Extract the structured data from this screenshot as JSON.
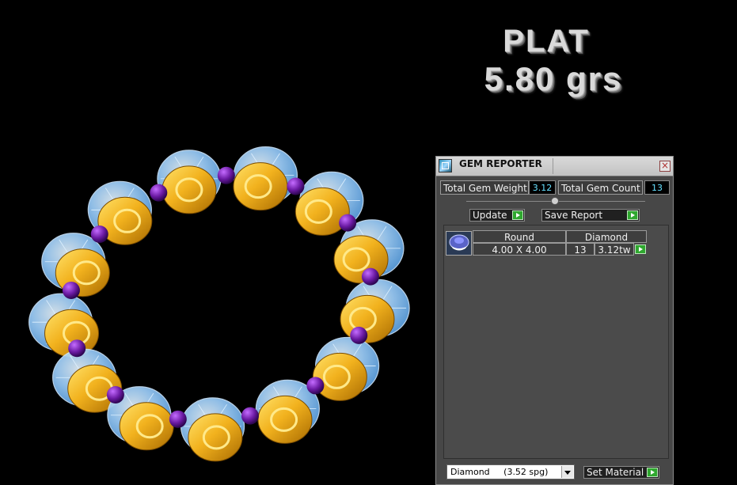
{
  "overlay": {
    "line1": "PLAT",
    "line2": "5.80 grs"
  },
  "panel": {
    "title": "GEM REPORTER",
    "close_label": "×",
    "total_gem_weight_label": "Total Gem Weight",
    "total_gem_weight_value": "3.12",
    "total_gem_count_label": "Total Gem Count",
    "total_gem_count_value": "13",
    "update_label": "Update",
    "save_report_label": "Save Report",
    "table": {
      "headers": [
        "Round",
        "Diamond"
      ],
      "rows": [
        {
          "size": "4.00 X 4.00",
          "count": "13",
          "weight": "3.12tw"
        }
      ]
    },
    "material_select_value": "Diamond     (3.52 spg)",
    "set_material_label": "Set Material"
  },
  "colors": {
    "background": "#000000",
    "metal_gold": "#f2b21e",
    "gem_blue": "#8ec9ff",
    "prong_purple": "#6b1aa3",
    "value_cyan": "#66e0ff",
    "play_green": "#2fa82f"
  }
}
